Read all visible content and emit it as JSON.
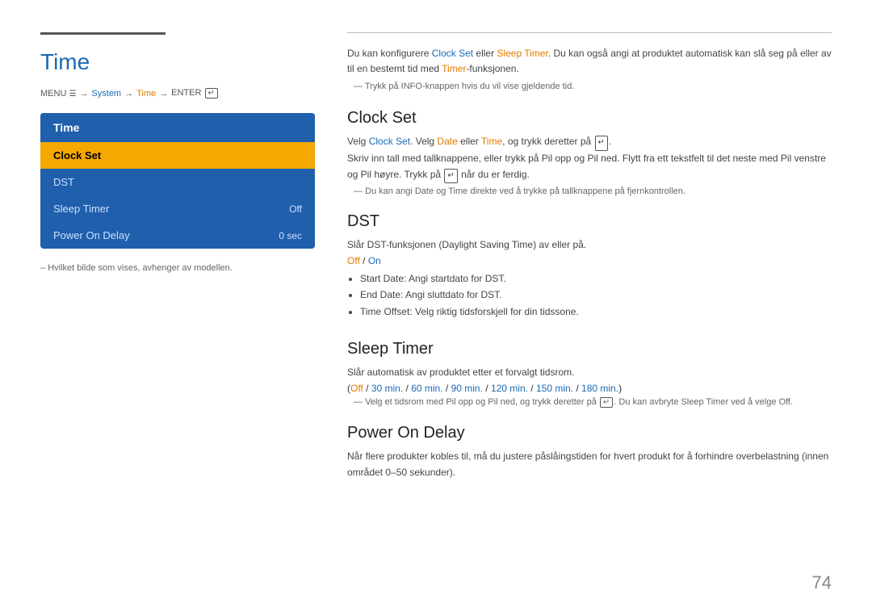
{
  "page": {
    "title": "Time",
    "number": "74"
  },
  "breadcrumb": {
    "menu": "MENU",
    "sep1": "→",
    "system": "System",
    "sep2": "→",
    "time": "Time",
    "sep3": "→",
    "enter": "ENTER"
  },
  "menu_panel": {
    "header": "Time",
    "items": [
      {
        "label": "Clock Set",
        "value": "",
        "active": true
      },
      {
        "label": "DST",
        "value": "",
        "active": false
      },
      {
        "label": "Sleep Timer",
        "value": "Off",
        "active": false
      },
      {
        "label": "Power On Delay",
        "value": "0 sec",
        "active": false
      }
    ]
  },
  "footnote": "Hvilket bilde som vises, avhenger av modellen.",
  "right": {
    "intro_line1": "Du kan konfigurere Clock Set eller Sleep Timer. Du kan også angi at produktet automatisk kan slå seg på eller av til",
    "intro_line2": "en bestemt tid med Timer-funksjonen.",
    "tip": "Trykk på INFO-knappen hvis du vil vise gjeldende tid.",
    "sections": [
      {
        "id": "clock-set",
        "title": "Clock Set",
        "body1": "Velg Clock Set. Velg Date eller Time, og trykk deretter på",
        "icon": "↵",
        "body2": "Skriv inn tall med tallknappene, eller trykk på Pil opp og Pil ned. Flytt fra ett tekstfelt til det neste med Pil venstre og Pil høyre. Trykk på",
        "icon2": "↵",
        "body3": "når du er ferdig.",
        "tip": "Du kan angi Date og Time direkte ved å trykke på tallknappene på fjernkontrollen."
      },
      {
        "id": "dst",
        "title": "DST",
        "body": "Slår DST-funksjonen (Daylight Saving Time) av eller på.",
        "options_label": "Off / On",
        "bullets": [
          "Start Date: Angi startdato for DST.",
          "End Date: Angi sluttdato for DST.",
          "Time Offset: Velg riktig tidsforskjell for din tidssone."
        ]
      },
      {
        "id": "sleep-timer",
        "title": "Sleep Timer",
        "body": "Slår automatisk av produktet etter et forvalgt tidsrom.",
        "options": "(Off / 30 min. / 60 min. / 90 min. / 120 min. / 150 min. / 180 min.)",
        "tip": "Velg et tidsrom med Pil opp og Pil ned, og trykk deretter på     . Du kan avbryte Sleep Timer ved å velge Off."
      },
      {
        "id": "power-on-delay",
        "title": "Power On Delay",
        "body": "Når flere produkter kobles til, må du justere påslåingstiden for hvert produkt for å forhindre overbelastning (innen området 0–50 sekunder)."
      }
    ]
  }
}
